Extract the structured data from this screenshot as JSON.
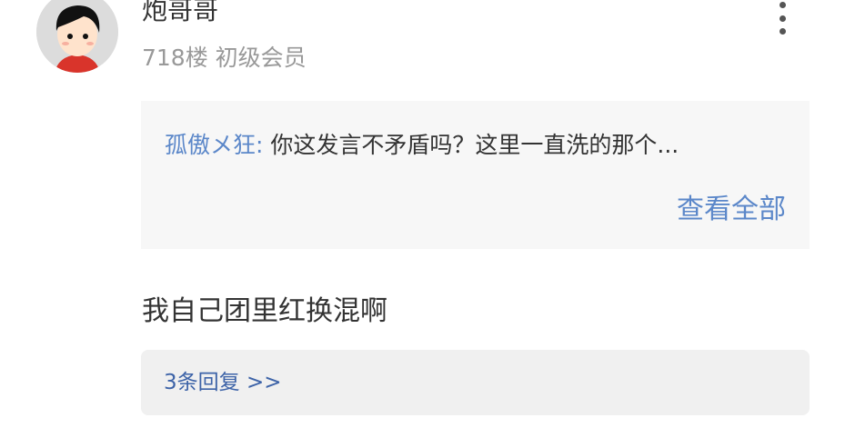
{
  "post": {
    "username": "炮哥哥",
    "meta": "718楼 初级会员",
    "avatar_icon": "cartoon-avatar-icon",
    "more_icon": "vertical-dots-icon"
  },
  "quote": {
    "author": "孤傲メ狂:",
    "text": "你这发言不矛盾吗？这里一直洗的那个...",
    "view_all_label": "查看全部"
  },
  "reply": {
    "text": "我自己团里红换混啊"
  },
  "replies": {
    "link_label": "3条回复 >>"
  },
  "colors": {
    "link_blue": "#5b87c9",
    "replies_blue": "#3d63a8",
    "text_dark": "#333333",
    "text_gray": "#999999",
    "quote_bg": "#f7f7f7",
    "replies_bg": "#f0f0f0"
  }
}
